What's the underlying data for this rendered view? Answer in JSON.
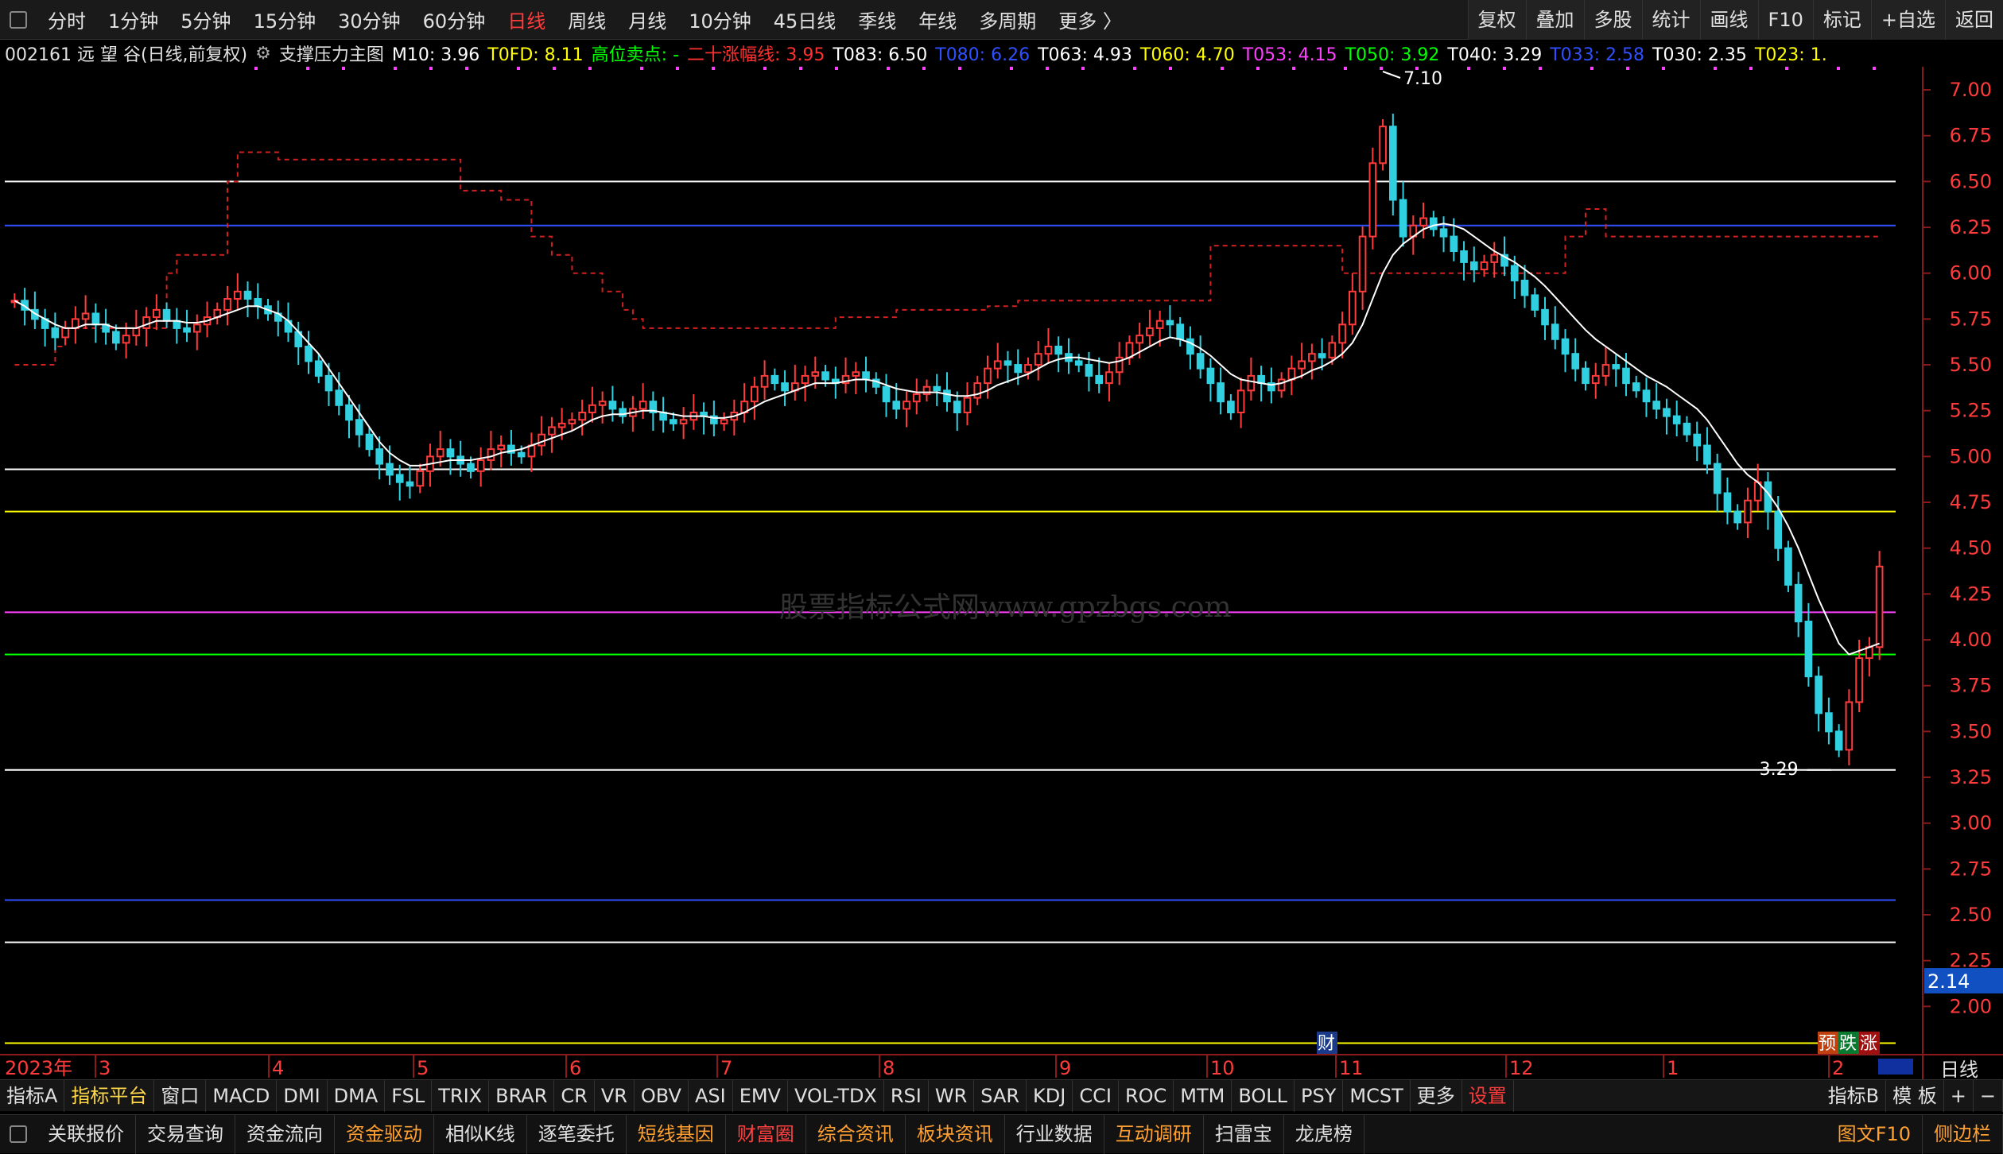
{
  "topbar": {
    "items": [
      {
        "label": "分时",
        "active": false
      },
      {
        "label": "1分钟",
        "active": false
      },
      {
        "label": "5分钟",
        "active": false
      },
      {
        "label": "15分钟",
        "active": false
      },
      {
        "label": "30分钟",
        "active": false
      },
      {
        "label": "60分钟",
        "active": false
      },
      {
        "label": "日线",
        "active": true
      },
      {
        "label": "周线",
        "active": false
      },
      {
        "label": "月线",
        "active": false
      },
      {
        "label": "10分钟",
        "active": false
      },
      {
        "label": "45日线",
        "active": false
      },
      {
        "label": "季线",
        "active": false
      },
      {
        "label": "年线",
        "active": false
      },
      {
        "label": "多周期",
        "active": false
      },
      {
        "label": "更多 〉",
        "active": false
      }
    ],
    "right_items": [
      "复权",
      "叠加",
      "多股",
      "统计",
      "画线",
      "F10",
      "标记",
      "+自选",
      "返回"
    ]
  },
  "infobar": {
    "stock": "002161 远 望 谷(日线,前复权)",
    "indicator_name": "支撑压力主图",
    "fields": [
      {
        "text": "M10: 3.96",
        "color": "#ffffff"
      },
      {
        "text": "T0FD: 8.11",
        "color": "#ffff00"
      },
      {
        "text": "高位卖点: -",
        "color": "#00ff00"
      },
      {
        "text": "二十涨幅线: 3.95",
        "color": "#ff3030"
      },
      {
        "text": "T083: 6.50",
        "color": "#ffffff"
      },
      {
        "text": "T080: 6.26",
        "color": "#3050ff"
      },
      {
        "text": "T063: 4.93",
        "color": "#ffffff"
      },
      {
        "text": "T060: 4.70",
        "color": "#ffff00"
      },
      {
        "text": "T053: 4.15",
        "color": "#ff40ff"
      },
      {
        "text": "T050: 3.92",
        "color": "#00ff00"
      },
      {
        "text": "T040: 3.29",
        "color": "#ffffff"
      },
      {
        "text": "T033: 2.58",
        "color": "#3050ff"
      },
      {
        "text": "T030: 2.35",
        "color": "#ffffff"
      },
      {
        "text": "T023: 1.",
        "color": "#ffff00"
      }
    ]
  },
  "watermark": "股票指标公式网www.gpzbgs.com",
  "chart_data": {
    "type": "candlestick",
    "yaxis_ticks": [
      "7.00",
      "6.75",
      "6.50",
      "6.25",
      "6.00",
      "5.75",
      "5.50",
      "5.25",
      "5.00",
      "4.75",
      "4.50",
      "4.25",
      "4.00",
      "3.75",
      "3.50",
      "3.25",
      "3.00",
      "2.75",
      "2.50",
      "2.25",
      "2.00"
    ],
    "ylim": [
      1.75,
      7.1
    ],
    "year_label": "2023年",
    "x_months": [
      "3",
      "4",
      "5",
      "6",
      "7",
      "8",
      "9",
      "10",
      "11",
      "12",
      "1",
      "2"
    ],
    "price_box_value": "2.14",
    "high_label": "7.10",
    "low_label": "3.29",
    "horizontal_lines": [
      {
        "value": 6.5,
        "color": "#ffffff"
      },
      {
        "value": 6.26,
        "color": "#3050ff"
      },
      {
        "value": 4.93,
        "color": "#ffffff"
      },
      {
        "value": 4.7,
        "color": "#ffff00"
      },
      {
        "value": 4.15,
        "color": "#ff40ff"
      },
      {
        "value": 3.92,
        "color": "#00ff00"
      },
      {
        "value": 3.29,
        "color": "#ffffff"
      },
      {
        "value": 2.58,
        "color": "#3050ff"
      },
      {
        "value": 2.35,
        "color": "#ffffff"
      },
      {
        "value": 1.8,
        "color": "#ffff00"
      }
    ],
    "close_series": [
      5.85,
      5.8,
      5.75,
      5.7,
      5.65,
      5.7,
      5.75,
      5.78,
      5.72,
      5.68,
      5.62,
      5.66,
      5.7,
      5.76,
      5.8,
      5.74,
      5.7,
      5.68,
      5.72,
      5.76,
      5.8,
      5.86,
      5.9,
      5.86,
      5.82,
      5.78,
      5.74,
      5.68,
      5.6,
      5.52,
      5.44,
      5.36,
      5.28,
      5.2,
      5.12,
      5.04,
      4.96,
      4.9,
      4.86,
      4.84,
      4.92,
      5.0,
      5.04,
      5.0,
      4.96,
      4.92,
      4.98,
      5.04,
      5.06,
      5.02,
      5.0,
      5.06,
      5.12,
      5.16,
      5.18,
      5.2,
      5.24,
      5.28,
      5.3,
      5.26,
      5.22,
      5.26,
      5.3,
      5.24,
      5.2,
      5.18,
      5.2,
      5.24,
      5.22,
      5.18,
      5.2,
      5.24,
      5.3,
      5.38,
      5.44,
      5.4,
      5.36,
      5.4,
      5.44,
      5.46,
      5.42,
      5.4,
      5.44,
      5.46,
      5.42,
      5.38,
      5.3,
      5.26,
      5.3,
      5.34,
      5.38,
      5.36,
      5.3,
      5.24,
      5.32,
      5.4,
      5.48,
      5.52,
      5.5,
      5.46,
      5.5,
      5.56,
      5.6,
      5.56,
      5.52,
      5.5,
      5.44,
      5.4,
      5.46,
      5.54,
      5.62,
      5.66,
      5.7,
      5.74,
      5.72,
      5.64,
      5.56,
      5.48,
      5.4,
      5.3,
      5.24,
      5.36,
      5.44,
      5.4,
      5.36,
      5.42,
      5.48,
      5.52,
      5.56,
      5.54,
      5.62,
      5.72,
      5.9,
      6.2,
      6.6,
      6.8,
      6.4,
      6.2,
      6.26,
      6.3,
      6.24,
      6.2,
      6.12,
      6.06,
      6.02,
      6.06,
      6.1,
      6.04,
      5.96,
      5.88,
      5.8,
      5.72,
      5.64,
      5.56,
      5.48,
      5.4,
      5.44,
      5.5,
      5.48,
      5.4,
      5.36,
      5.3,
      5.26,
      5.22,
      5.18,
      5.12,
      5.06,
      4.96,
      4.8,
      4.7,
      4.64,
      4.76,
      4.86,
      4.7,
      4.5,
      4.3,
      4.1,
      3.8,
      3.6,
      3.5,
      3.4,
      3.66,
      3.9,
      3.96,
      4.4
    ],
    "ma10_series": [
      5.85,
      5.82,
      5.78,
      5.75,
      5.72,
      5.7,
      5.7,
      5.72,
      5.72,
      5.72,
      5.7,
      5.7,
      5.7,
      5.72,
      5.74,
      5.74,
      5.74,
      5.73,
      5.73,
      5.74,
      5.76,
      5.78,
      5.8,
      5.82,
      5.82,
      5.8,
      5.78,
      5.74,
      5.68,
      5.62,
      5.56,
      5.48,
      5.4,
      5.32,
      5.24,
      5.16,
      5.08,
      5.02,
      4.98,
      4.95,
      4.95,
      4.96,
      4.97,
      4.98,
      4.98,
      4.98,
      4.99,
      5.0,
      5.02,
      5.03,
      5.04,
      5.06,
      5.08,
      5.1,
      5.12,
      5.14,
      5.17,
      5.2,
      5.22,
      5.23,
      5.23,
      5.24,
      5.25,
      5.25,
      5.24,
      5.23,
      5.22,
      5.22,
      5.22,
      5.21,
      5.21,
      5.22,
      5.24,
      5.27,
      5.3,
      5.32,
      5.34,
      5.36,
      5.38,
      5.4,
      5.4,
      5.4,
      5.41,
      5.42,
      5.42,
      5.41,
      5.39,
      5.37,
      5.36,
      5.35,
      5.35,
      5.35,
      5.34,
      5.33,
      5.33,
      5.34,
      5.36,
      5.39,
      5.41,
      5.43,
      5.45,
      5.48,
      5.51,
      5.53,
      5.54,
      5.54,
      5.53,
      5.52,
      5.51,
      5.52,
      5.54,
      5.57,
      5.6,
      5.63,
      5.65,
      5.64,
      5.62,
      5.59,
      5.55,
      5.5,
      5.45,
      5.42,
      5.41,
      5.4,
      5.39,
      5.4,
      5.42,
      5.44,
      5.47,
      5.49,
      5.52,
      5.56,
      5.62,
      5.72,
      5.86,
      6.0,
      6.1,
      6.16,
      6.2,
      6.24,
      6.26,
      6.27,
      6.26,
      6.24,
      6.2,
      6.16,
      6.12,
      6.09,
      6.06,
      6.02,
      5.98,
      5.93,
      5.87,
      5.81,
      5.75,
      5.69,
      5.64,
      5.6,
      5.56,
      5.52,
      5.48,
      5.44,
      5.41,
      5.38,
      5.34,
      5.3,
      5.26,
      5.2,
      5.12,
      5.04,
      4.96,
      4.9,
      4.86,
      4.8,
      4.72,
      4.62,
      4.5,
      4.36,
      4.22,
      4.1,
      3.98,
      3.92,
      3.94,
      3.96,
      3.98
    ],
    "resistance_series": [
      5.5,
      5.5,
      5.5,
      5.5,
      5.6,
      5.7,
      5.7,
      5.7,
      5.7,
      5.7,
      5.7,
      5.7,
      5.7,
      5.7,
      5.7,
      6.0,
      6.1,
      6.1,
      6.1,
      6.1,
      6.1,
      6.5,
      6.66,
      6.66,
      6.66,
      6.66,
      6.62,
      6.62,
      6.62,
      6.62,
      6.62,
      6.62,
      6.62,
      6.62,
      6.62,
      6.62,
      6.62,
      6.62,
      6.62,
      6.62,
      6.62,
      6.62,
      6.62,
      6.62,
      6.45,
      6.45,
      6.45,
      6.45,
      6.4,
      6.4,
      6.4,
      6.2,
      6.2,
      6.1,
      6.1,
      6.0,
      6.0,
      6.0,
      5.9,
      5.9,
      5.8,
      5.75,
      5.7,
      5.7,
      5.7,
      5.7,
      5.7,
      5.7,
      5.7,
      5.7,
      5.7,
      5.7,
      5.7,
      5.7,
      5.7,
      5.7,
      5.7,
      5.7,
      5.7,
      5.7,
      5.7,
      5.76,
      5.76,
      5.76,
      5.76,
      5.76,
      5.76,
      5.8,
      5.8,
      5.8,
      5.8,
      5.8,
      5.8,
      5.8,
      5.8,
      5.8,
      5.82,
      5.82,
      5.82,
      5.85,
      5.85,
      5.85,
      5.85,
      5.85,
      5.85,
      5.85,
      5.85,
      5.85,
      5.85,
      5.85,
      5.85,
      5.85,
      5.85,
      5.85,
      5.85,
      5.85,
      5.85,
      5.85,
      6.15,
      6.15,
      6.15,
      6.15,
      6.15,
      6.15,
      6.15,
      6.15,
      6.15,
      6.15,
      6.15,
      6.15,
      6.15,
      6.0,
      6.0,
      6.0,
      6.0,
      6.0,
      6.0,
      6.0,
      6.0,
      6.0,
      6.0,
      6.0,
      6.0,
      6.0,
      6.0,
      6.0,
      6.0,
      6.0,
      6.0,
      6.0,
      6.0,
      6.0,
      6.0,
      6.2,
      6.2,
      6.35,
      6.35,
      6.2,
      6.2,
      6.2,
      6.2,
      6.2,
      6.2,
      6.2,
      6.2,
      6.2,
      6.2,
      6.2,
      6.2,
      6.2,
      6.2,
      6.2,
      6.2,
      6.2,
      6.2,
      6.2,
      6.2,
      6.2,
      6.2,
      6.2,
      6.2,
      6.2,
      6.2,
      6.2,
      6.2,
      6.2,
      6.2,
      6.2,
      6.2,
      6.2,
      6.2,
      6.2,
      6.2,
      6.2,
      6.2,
      6.2,
      6.2,
      6.2,
      6.2,
      6.2,
      6.2,
      6.2,
      6.2,
      6.2,
      6.2,
      6.2,
      6.2,
      6.2,
      6.2,
      6.2,
      6.2,
      6.2,
      6.2,
      6.2,
      6.2,
      6.2,
      6.2,
      6.2,
      6.2,
      6.2,
      6.2,
      6.2,
      6.2,
      6.2,
      6.2,
      6.2,
      6.2,
      6.2,
      6.2,
      6.2,
      6.2
    ]
  },
  "markers": {
    "cai": "财",
    "yu": "预",
    "die": "跌",
    "zhang": "涨"
  },
  "period_label": "日线",
  "tabbar": {
    "tabs": [
      {
        "label": "指标A",
        "style": ""
      },
      {
        "label": "指标平台",
        "style": "yellow"
      },
      {
        "label": "窗口",
        "style": ""
      },
      {
        "label": "MACD",
        "style": ""
      },
      {
        "label": "DMI",
        "style": ""
      },
      {
        "label": "DMA",
        "style": ""
      },
      {
        "label": "FSL",
        "style": ""
      },
      {
        "label": "TRIX",
        "style": ""
      },
      {
        "label": "BRAR",
        "style": ""
      },
      {
        "label": "CR",
        "style": ""
      },
      {
        "label": "VR",
        "style": ""
      },
      {
        "label": "OBV",
        "style": ""
      },
      {
        "label": "ASI",
        "style": ""
      },
      {
        "label": "EMV",
        "style": ""
      },
      {
        "label": "VOL-TDX",
        "style": ""
      },
      {
        "label": "RSI",
        "style": ""
      },
      {
        "label": "WR",
        "style": ""
      },
      {
        "label": "SAR",
        "style": ""
      },
      {
        "label": "KDJ",
        "style": ""
      },
      {
        "label": "CCI",
        "style": ""
      },
      {
        "label": "ROC",
        "style": ""
      },
      {
        "label": "MTM",
        "style": ""
      },
      {
        "label": "BOLL",
        "style": ""
      },
      {
        "label": "PSY",
        "style": ""
      },
      {
        "label": "MCST",
        "style": ""
      },
      {
        "label": "更多",
        "style": ""
      },
      {
        "label": "设置",
        "style": "red"
      }
    ],
    "right": [
      "指标B",
      "模 板",
      "+",
      "−"
    ]
  },
  "bottombar": {
    "buttons": [
      {
        "label": "关联报价",
        "color": "#e0e0e0"
      },
      {
        "label": "交易查询",
        "color": "#e0e0e0"
      },
      {
        "label": "资金流向",
        "color": "#e0e0e0"
      },
      {
        "label": "资金驱动",
        "color": "#ffa030"
      },
      {
        "label": "相似K线",
        "color": "#e0e0e0"
      },
      {
        "label": "逐笔委托",
        "color": "#e0e0e0"
      },
      {
        "label": "短线基因",
        "color": "#ffa030"
      },
      {
        "label": "财富圈",
        "color": "#ff4040"
      },
      {
        "label": "综合资讯",
        "color": "#ffa030"
      },
      {
        "label": "板块资讯",
        "color": "#ffa030"
      },
      {
        "label": "行业数据",
        "color": "#e0e0e0"
      },
      {
        "label": "互动调研",
        "color": "#ffa030"
      },
      {
        "label": "扫雷宝",
        "color": "#e0e0e0"
      },
      {
        "label": "龙虎榜",
        "color": "#e0e0e0"
      }
    ],
    "right": [
      {
        "label": "图文F10",
        "color": "#ffa030"
      },
      {
        "label": "侧边栏",
        "color": "#ffa030"
      }
    ]
  }
}
